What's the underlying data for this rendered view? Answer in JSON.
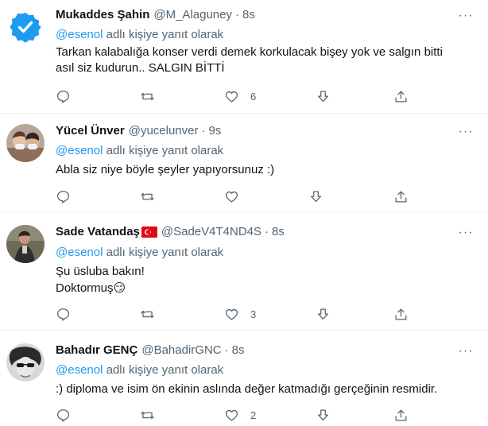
{
  "tweets": [
    {
      "name": "Mukaddes Şahin",
      "handle": "@M_Alaguney",
      "time": "8s",
      "reply_mention": "@esenol",
      "reply_text": " adlı kişiye yanıt olarak",
      "text": "Tarkan kalabalığa konser verdi demek korkulacak bişey yok ve salgın bitti\nasıl siz kudurun.. SALGIN BİTTİ",
      "reply_count": "",
      "retweet_count": "",
      "like_count": "6"
    },
    {
      "name": "Yücel Ünver",
      "handle": "@yucelunver",
      "time": "9s",
      "reply_mention": "@esenol",
      "reply_text": " adlı kişiye yanıt olarak",
      "text": "Abla siz niye böyle şeyler yapıyorsunuz :)",
      "reply_count": "",
      "retweet_count": "",
      "like_count": ""
    },
    {
      "name": "Sade Vatandaş",
      "handle": "@SadeV4T4ND4S",
      "time": "8s",
      "reply_mention": "@esenol",
      "reply_text": " adlı kişiye yanıt olarak",
      "text": "Şu üsluba bakın!\nDoktormuş😏",
      "reply_count": "",
      "retweet_count": "",
      "like_count": "3"
    },
    {
      "name": "Bahadır GENÇ",
      "handle": "@BahadirGNC",
      "time": "8s",
      "reply_mention": "@esenol",
      "reply_text": " adlı kişiye yanıt olarak",
      "text": ":) diploma ve isim ön ekinin aslında değer katmadığı gerçeğinin resmidir.",
      "reply_count": "",
      "retweet_count": "",
      "like_count": "2"
    }
  ],
  "separator": "·",
  "more_glyph": "···",
  "colors": {
    "accent": "#1d9bf0",
    "muted": "#536471",
    "text": "#0f1419",
    "border": "#eff3f4"
  }
}
